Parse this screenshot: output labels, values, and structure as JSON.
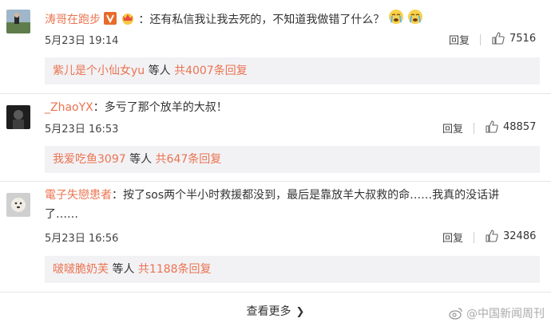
{
  "comments": [
    {
      "username": "涛哥在跑步",
      "text": "：还有私信我让我去死的，不知道我做错了什么？",
      "time": "5月23日 19:14",
      "reply_label": "回复",
      "likes": "7516",
      "sub": {
        "name": "紫儿是个小仙女yu",
        "mid": " 等人 ",
        "count": "共4007条回复"
      }
    },
    {
      "username": "_ZhaoYX",
      "text": "：多亏了那个放羊的大叔！",
      "time": "5月23日 16:53",
      "reply_label": "回复",
      "likes": "48857",
      "sub": {
        "name": "我爱吃鱼3097",
        "mid": " 等人 ",
        "count": "共647条回复"
      }
    },
    {
      "username": "電子失戀患者",
      "text_line1": "：按了sos两个半小时救援都没到，最后是靠放羊大叔救的命……我真的没话讲",
      "text_line2": "了……",
      "time": "5月23日 16:56",
      "reply_label": "回复",
      "likes": "32486",
      "sub": {
        "name": "啵啵脆奶芙",
        "mid": " 等人 ",
        "count": "共1188条回复"
      }
    }
  ],
  "more_label": "查看更多",
  "watermark": "@中国新闻周刊",
  "colors": {
    "username": "#eb7350",
    "sub_bg": "#f2f2f5",
    "text": "#333333"
  },
  "icons": [
    "verified-v-icon",
    "crown-badge-icon",
    "crying-emoji-icon",
    "thumb-up-icon",
    "chevron-right-icon",
    "weibo-logo-icon"
  ]
}
